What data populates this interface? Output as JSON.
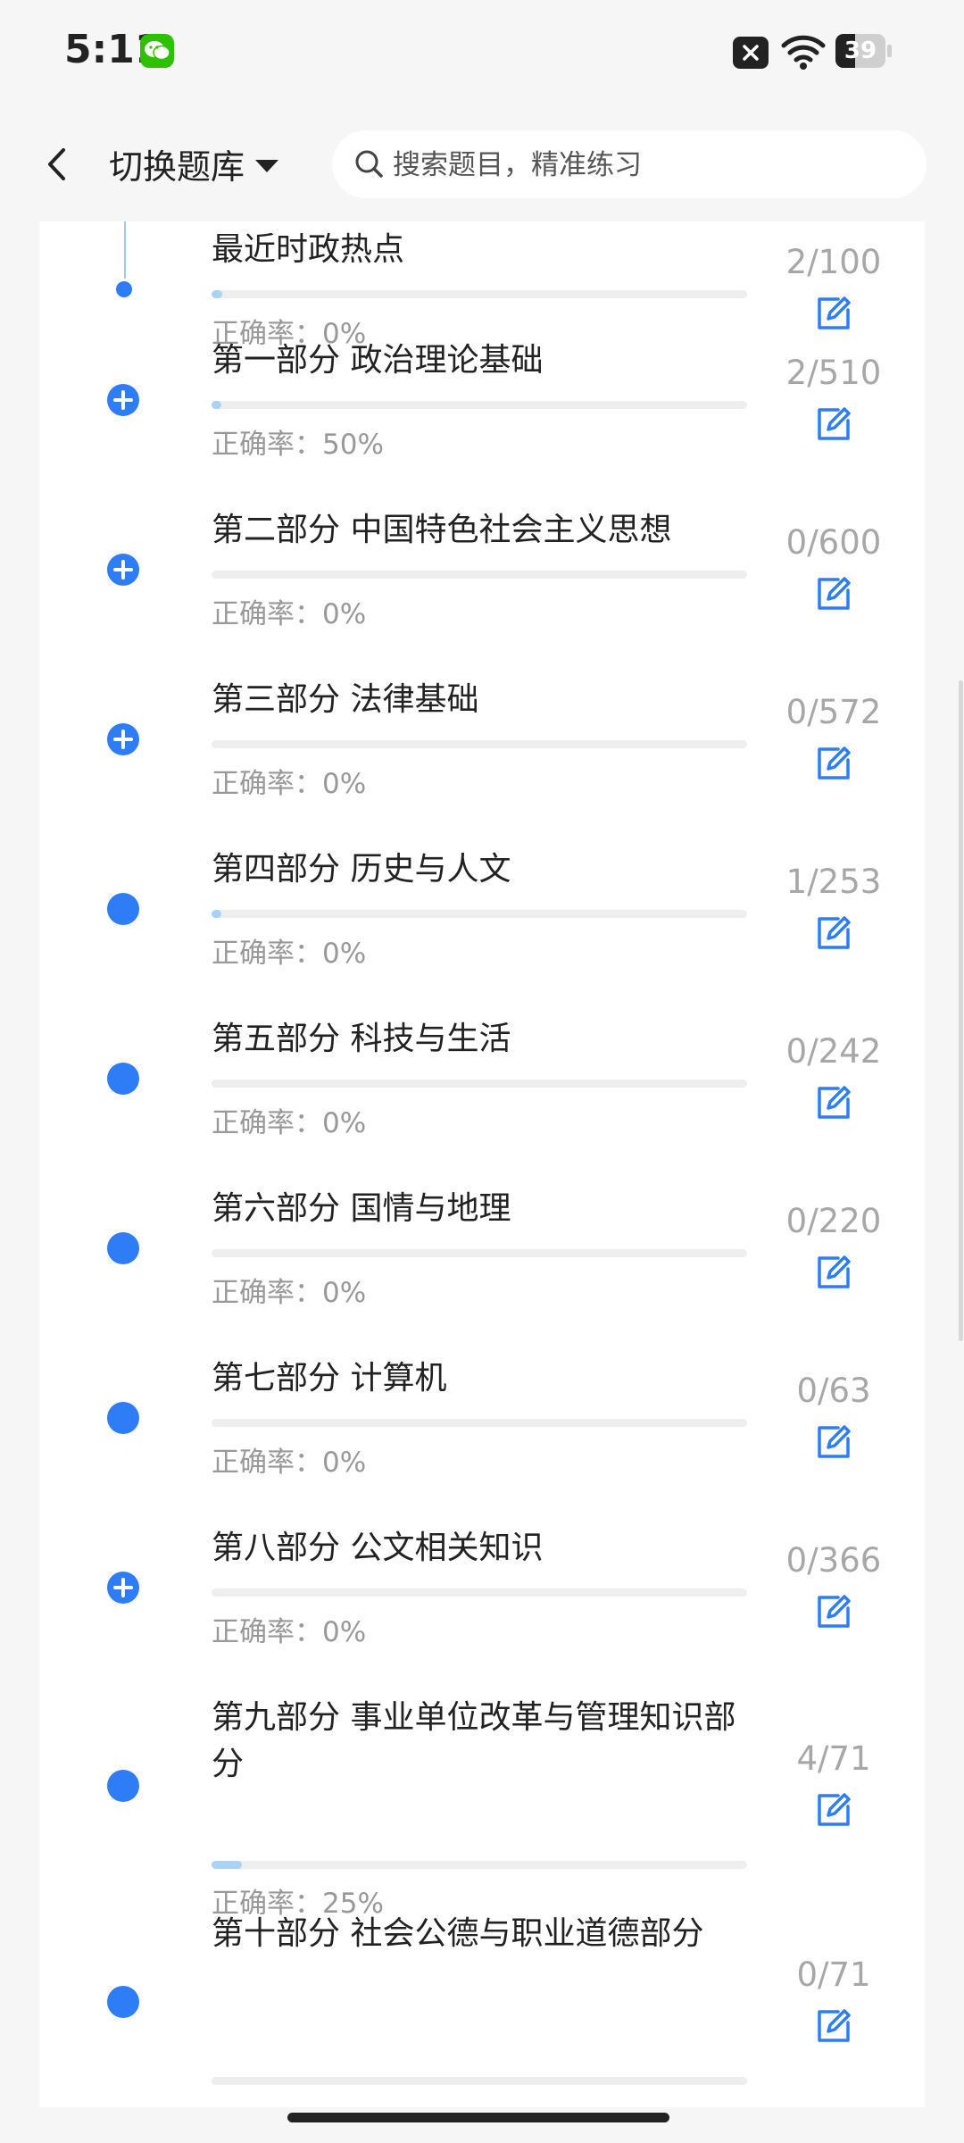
{
  "status_bar": {
    "time": "5:11",
    "battery_percent": 39,
    "battery_level": 0.39,
    "icons": [
      "wechat-icon",
      "close-notification-icon",
      "wifi-icon",
      "battery-icon"
    ]
  },
  "header": {
    "back_icon": "chevron-left-icon",
    "switch_label": "切换题库",
    "search_placeholder": "搜索题目，精准练习"
  },
  "accuracy_prefix": "正确率：",
  "sections": [
    {
      "title": "最近时政热点",
      "progress": "2/100",
      "progress_fraction": 0.02,
      "accuracy": "正确率：0%",
      "node": "dot",
      "expandable": false
    },
    {
      "title": "第一部分 政治理论基础",
      "progress": "2/510",
      "progress_fraction": 0.004,
      "accuracy": "正确率：50%",
      "node": "plus",
      "expandable": true
    },
    {
      "title": "第二部分 中国特色社会主义思想",
      "progress": "0/600",
      "progress_fraction": 0,
      "accuracy": "正确率：0%",
      "node": "plus",
      "expandable": true
    },
    {
      "title": "第三部分 法律基础",
      "progress": "0/572",
      "progress_fraction": 0,
      "accuracy": "正确率：0%",
      "node": "plus",
      "expandable": true
    },
    {
      "title": "第四部分 历史与人文",
      "progress": "1/253",
      "progress_fraction": 0.004,
      "accuracy": "正确率：0%",
      "node": "dot",
      "expandable": false
    },
    {
      "title": "第五部分 科技与生活",
      "progress": "0/242",
      "progress_fraction": 0,
      "accuracy": "正确率：0%",
      "node": "dot",
      "expandable": false
    },
    {
      "title": "第六部分 国情与地理",
      "progress": "0/220",
      "progress_fraction": 0,
      "accuracy": "正确率：0%",
      "node": "dot",
      "expandable": false
    },
    {
      "title": "第七部分 计算机",
      "progress": "0/63",
      "progress_fraction": 0,
      "accuracy": "正确率：0%",
      "node": "dot",
      "expandable": false
    },
    {
      "title": "第八部分 公文相关知识",
      "progress": "0/366",
      "progress_fraction": 0,
      "accuracy": "正确率：0%",
      "node": "plus",
      "expandable": true
    },
    {
      "title": "第九部分 事业单位改革与管理知识部分",
      "progress": "4/71",
      "progress_fraction": 0.056,
      "accuracy": "正确率：25%",
      "node": "dot",
      "expandable": false
    },
    {
      "title": "第十部分 社会公德与职业道德部分",
      "progress": "0/71",
      "progress_fraction": 0,
      "accuracy": "",
      "node": "dot",
      "expandable": false
    }
  ],
  "colors": {
    "accent": "#2f7df6",
    "progress_fill": "#a9d3f5",
    "progress_track": "#eeeeee",
    "muted_text": "#999999",
    "count_text": "#a7a7a7",
    "background": "#f6f6f7",
    "card": "#ffffff"
  },
  "row_icons": {
    "edit": "edit-note-icon",
    "expand": "plus-circle-icon",
    "leaf": "dot-icon"
  }
}
